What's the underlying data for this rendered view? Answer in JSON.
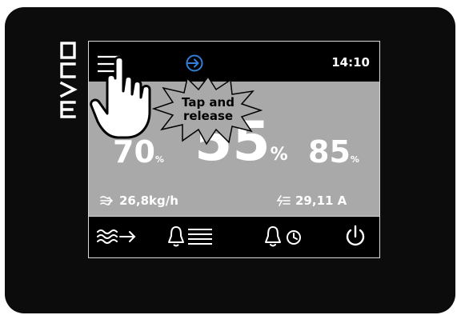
{
  "header": {
    "time": "14:10"
  },
  "readings": {
    "left": {
      "value": "70",
      "unit": "%"
    },
    "center": {
      "value": "55",
      "unit": "%"
    },
    "right": {
      "value": "85",
      "unit": "%"
    }
  },
  "stats": {
    "flow": "26,8kg/h",
    "current": "29,11 A"
  },
  "callout": {
    "line1": "Tap and",
    "line2": "release"
  },
  "icons": {
    "brand": "evco-logo",
    "menu": "menu-icon",
    "login": "login-arrow-icon",
    "flow": "flow-arrow-icon",
    "current": "heater-current-icon",
    "steam": "steam-output-icon",
    "alarm_list": "alarm-list-icon",
    "alarm_history": "alarm-history-icon",
    "power": "power-icon",
    "hand": "pointing-hand-icon"
  },
  "colors": {
    "accent": "#2f7fd8",
    "panel": "#a9a9a9",
    "device": "#0c0c0c"
  }
}
